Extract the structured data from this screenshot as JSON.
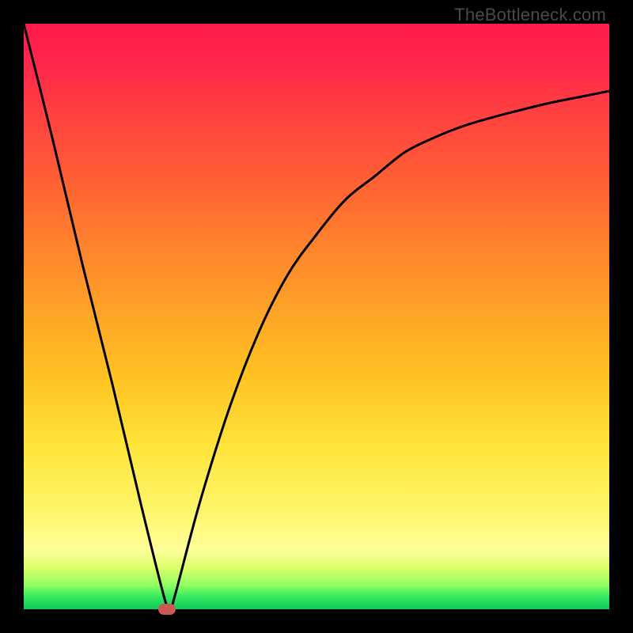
{
  "watermark": "TheBottleneck.com",
  "chart_data": {
    "type": "line",
    "title": "",
    "xlabel": "",
    "ylabel": "",
    "xlim": [
      0,
      100
    ],
    "ylim": [
      0,
      100
    ],
    "grid": false,
    "legend": false,
    "series": [
      {
        "name": "curve",
        "x": [
          0,
          5,
          10,
          15,
          20,
          24,
          25,
          26,
          30,
          35,
          40,
          45,
          50,
          55,
          60,
          65,
          70,
          75,
          80,
          85,
          90,
          95,
          100
        ],
        "y": [
          100,
          80,
          59,
          39,
          18,
          2,
          0,
          3,
          18,
          34,
          47,
          57,
          64,
          70,
          74,
          78,
          80.5,
          82.5,
          84,
          85.3,
          86.5,
          87.5,
          88.5
        ]
      }
    ],
    "marker": {
      "x": 24.5,
      "y": 0,
      "color": "#c95a55"
    },
    "background_gradient": {
      "top": "#ff1a4d",
      "mid_upper": "#ff7a2e",
      "mid": "#ffc222",
      "mid_lower": "#fff56a",
      "bottom": "#14c95a"
    },
    "frame_color": "#000000",
    "curve_color": "#000000"
  }
}
